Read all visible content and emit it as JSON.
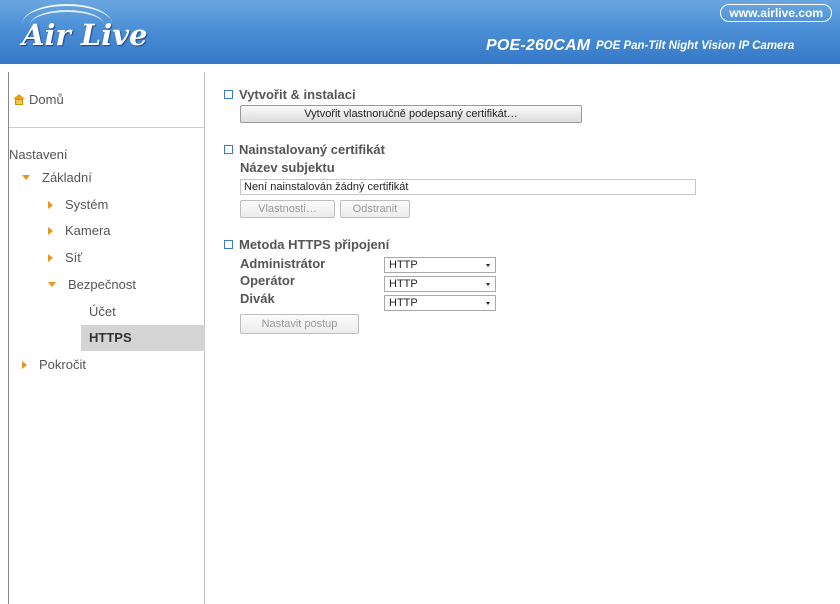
{
  "header": {
    "logo": "Air Live",
    "site_link": "www.airlive.com",
    "model": "POE-260CAM",
    "model_desc": "POE Pan-Tilt Night Vision IP Camera"
  },
  "sidebar": {
    "home": "Domů",
    "settings": "Nastavení",
    "basic": "Základní",
    "system": "Systém",
    "camera": "Kamera",
    "network": "Síť",
    "security": "Bezpečnost",
    "account": "Účet",
    "https": "HTTPS",
    "advanced": "Pokročit"
  },
  "create": {
    "title": "Vytvořit & instalaci",
    "button": "Vytvořit vlastnoručně podepsaný certifikát…"
  },
  "installed": {
    "title": "Nainstalovaný certifikát",
    "subject_label": "Název subjektu",
    "subject_value": "Není nainstalován žádný certifikát",
    "properties_button": "Vlastnosti…",
    "remove_button": "Odstranit"
  },
  "https_method": {
    "title": "Metoda HTTPS připojení",
    "rows": [
      {
        "label": "Administrátor",
        "value": "HTTP"
      },
      {
        "label": "Operátor",
        "value": "HTTP"
      },
      {
        "label": "Divák",
        "value": "HTTP"
      }
    ],
    "apply_button": "Nastavit postup"
  },
  "colors": {
    "header_blue": "#4b8fd6",
    "accent_orange": "#e7961c",
    "checkbox_blue": "#3b7ac8",
    "active_bg": "#d4d4d4"
  }
}
